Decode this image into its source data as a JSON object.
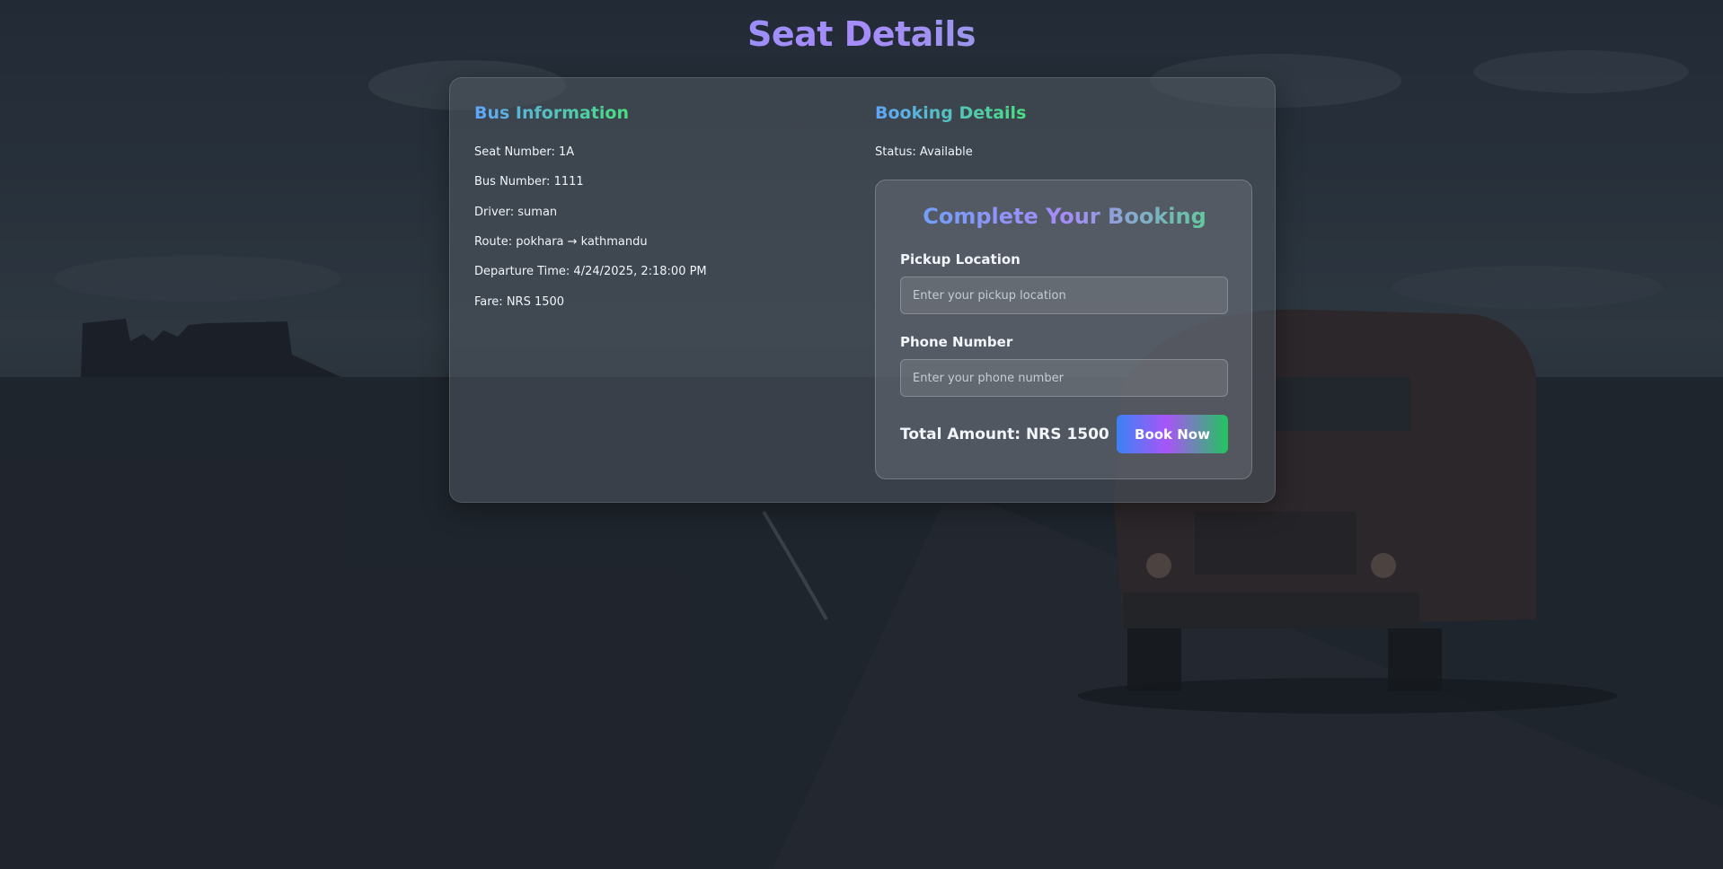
{
  "page": {
    "title": "Seat Details"
  },
  "bus_info": {
    "heading": "Bus Information",
    "seat_number": "Seat Number: 1A",
    "bus_number": "Bus Number: 1111",
    "driver": "Driver: suman",
    "route": "Route: pokhara → kathmandu",
    "departure": "Departure Time: 4/24/2025, 2:18:00 PM",
    "fare": "Fare: NRS 1500"
  },
  "booking_details": {
    "heading": "Booking Details",
    "status": "Status: Available"
  },
  "booking_form": {
    "title": "Complete Your Booking",
    "pickup_label": "Pickup Location",
    "pickup_placeholder": "Enter your pickup location",
    "pickup_value": "",
    "phone_label": "Phone Number",
    "phone_placeholder": "Enter your phone number",
    "phone_value": "",
    "total_amount": "Total Amount: NRS 1500",
    "book_button": "Book Now"
  },
  "colors": {
    "gradient_blue": "#60a5fa",
    "gradient_purple": "#a78bfa",
    "gradient_green": "#4ade80",
    "button_blue": "#3b82f6",
    "button_purple": "#a855f7",
    "button_green": "#22c55e",
    "text": "#f1f5f9"
  }
}
